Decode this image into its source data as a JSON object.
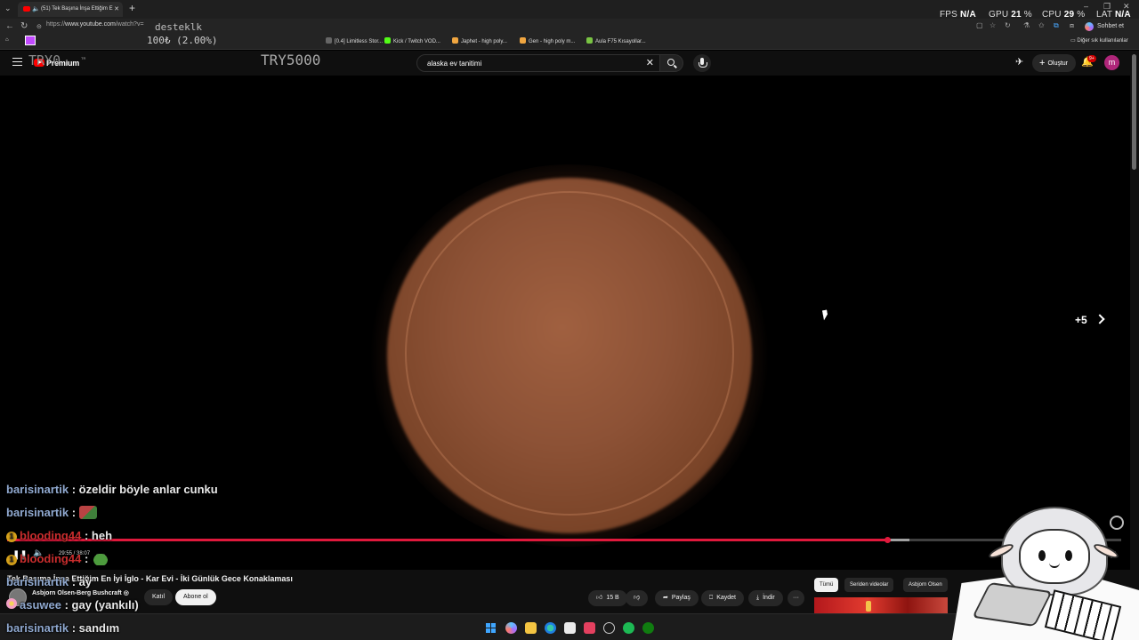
{
  "browser": {
    "tab_title": "(51) Tek Başına İnşa Ettiğim E",
    "url_prefix": "https://",
    "url_domain": "www.youtube.com",
    "url_path": "/watch?v=",
    "chat_button": "Sohbet et",
    "other_bookmarks": "Diğer sık kullanılanlar",
    "bookmarks": [
      {
        "label": "[0.4] Limitless Stor...",
        "color": "#666666"
      },
      {
        "label": "Kick / Twitch VOD...",
        "color": "#53fc18"
      },
      {
        "label": "Japhet - high poly...",
        "color": "#f0a640"
      },
      {
        "label": "Gen - high poly m...",
        "color": "#f0a640"
      },
      {
        "label": "Aula F75 Kısayollar...",
        "color": "#79c443"
      }
    ]
  },
  "overlay": {
    "fps_label": "FPS",
    "fps_value": "N/A",
    "gpu_label": "GPU",
    "gpu_value": "21",
    "cpu_label": "CPU",
    "cpu_value": "29",
    "lat_label": "LAT",
    "lat_value": "N/A",
    "percent_unit": "%",
    "desteklk": "desteklk",
    "progress_text": "100₺ (2.00%)",
    "try0": "TRY0",
    "try5000": "TRY5000"
  },
  "youtube": {
    "logo_text": "Premium",
    "logo_region": "TR",
    "search_query": "alaska ev tanitimi",
    "create_label": "Oluştur",
    "notif_count": "9+",
    "avatar_letter": "m"
  },
  "video": {
    "next_count": "+5",
    "time_text": "29:55 / 38:07",
    "played_fraction": 0.79,
    "buffered_fraction": 0.81,
    "title": "Tek Başıma İnşa Ettiğim En İyi İglo - Kar Evi - İki Günlük Gece Konaklaması",
    "channel": "Asbjorn Olsen-Berg Bushcraft",
    "subscribers": "",
    "join_label": "Katıl",
    "subscribe_label": "Abone ol",
    "likes": "15 B",
    "share_label": "Paylaş",
    "save_label": "Kaydet",
    "download_label": "İndir",
    "more_label": "···",
    "chips": [
      "Tümü",
      "Seriden videolar",
      "Asbjorn Olsen"
    ]
  },
  "chat": [
    {
      "user": "barisinartik",
      "message": "özeldir böyle anlar cunku",
      "badge": "",
      "emote": ""
    },
    {
      "user": "barisinartik",
      "message": "",
      "badge": "",
      "emote": "book"
    },
    {
      "user": "blooding44",
      "message": "heh",
      "badge": "1",
      "emote": ""
    },
    {
      "user": "blooding44",
      "message": "",
      "badge": "1",
      "emote": "frog"
    },
    {
      "user": "barisinartik",
      "message": "ay",
      "badge": "",
      "emote": ""
    },
    {
      "user": "asuwee",
      "message": "gay (yankılı)",
      "badge": "flower",
      "emote": ""
    },
    {
      "user": "barisinartik",
      "message": "sandım",
      "badge": "",
      "emote": ""
    }
  ]
}
